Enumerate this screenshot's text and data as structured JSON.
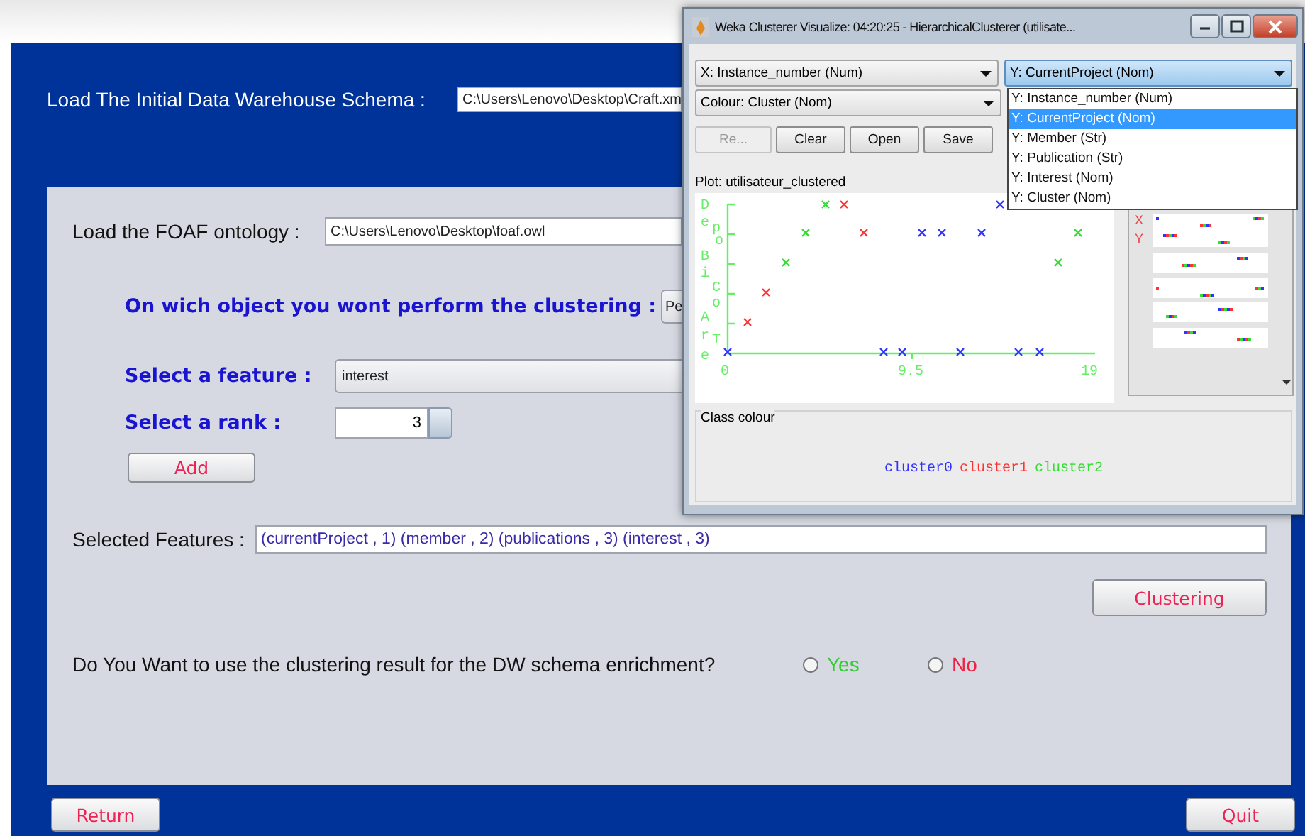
{
  "schema": {
    "label": "Load The Initial Data Warehouse Schema :",
    "path": "C:\\Users\\Lenovo\\Desktop\\Craft.xm"
  },
  "panel": {
    "ontology": {
      "label": "Load the FOAF ontology :",
      "path": "C:\\Users\\Lenovo\\Desktop\\foaf.owl"
    },
    "object": {
      "label": "On wich object you wont perform the clustering :",
      "value": "Pe"
    },
    "feature": {
      "label": "Select a feature :",
      "value": "interest"
    },
    "rank": {
      "label": "Select a rank :",
      "value": "3"
    },
    "add_button": "Add",
    "selected_features": {
      "label": "Selected Features :",
      "value": "(currentProject , 1) (member , 2) (publications , 3) (interest , 3)"
    },
    "clustering_button": "Clustering",
    "enrichment": {
      "question": "Do You Want to use the clustering result for the DW schema enrichment?",
      "options": [
        {
          "label": "Yes",
          "selected": false,
          "color": "#33cc33"
        },
        {
          "label": "No",
          "selected": false,
          "color": "#ee2244"
        }
      ]
    }
  },
  "buttons": [
    "Return",
    "Quit"
  ],
  "visualizer": {
    "title": "Weka Clusterer Visualize: 04:20:25 - HierarchicalClusterer (utilisate...",
    "x_axis": "X: Instance_number (Num)",
    "y_axis": "Y: CurrentProject (Nom)",
    "colour": "Colour: Cluster (Nom)",
    "y_menu": [
      {
        "label": "Y: Instance_number (Num)",
        "selected": false
      },
      {
        "label": "Y: CurrentProject (Nom)",
        "selected": true
      },
      {
        "label": "Y: Member (Str)",
        "selected": false
      },
      {
        "label": "Y: Publication (Str)",
        "selected": false
      },
      {
        "label": "Y: Interest (Nom)",
        "selected": false
      },
      {
        "label": "Y: Cluster (Nom)",
        "selected": false
      }
    ],
    "tools": [
      {
        "label": "Re...",
        "disabled": true
      },
      {
        "label": "Clear",
        "disabled": false
      },
      {
        "label": "Open",
        "disabled": false
      },
      {
        "label": "Save",
        "disabled": false
      }
    ],
    "plot_title": "Plot: utilisateur_clustered",
    "y_letters": [
      "D",
      "e",
      "p",
      "o",
      "B",
      "i",
      "C",
      "o",
      "A",
      "r",
      "T",
      "e"
    ],
    "x_ticks": [
      "0",
      "9.5",
      "19"
    ],
    "attribute_letters": [
      "X",
      "Y"
    ],
    "class_colour_title": "Class colour",
    "clusters": [
      {
        "name": "cluster0",
        "color": "#3333ff"
      },
      {
        "name": "cluster1",
        "color": "#ff3333"
      },
      {
        "name": "cluster2",
        "color": "#33dd33"
      }
    ]
  }
}
